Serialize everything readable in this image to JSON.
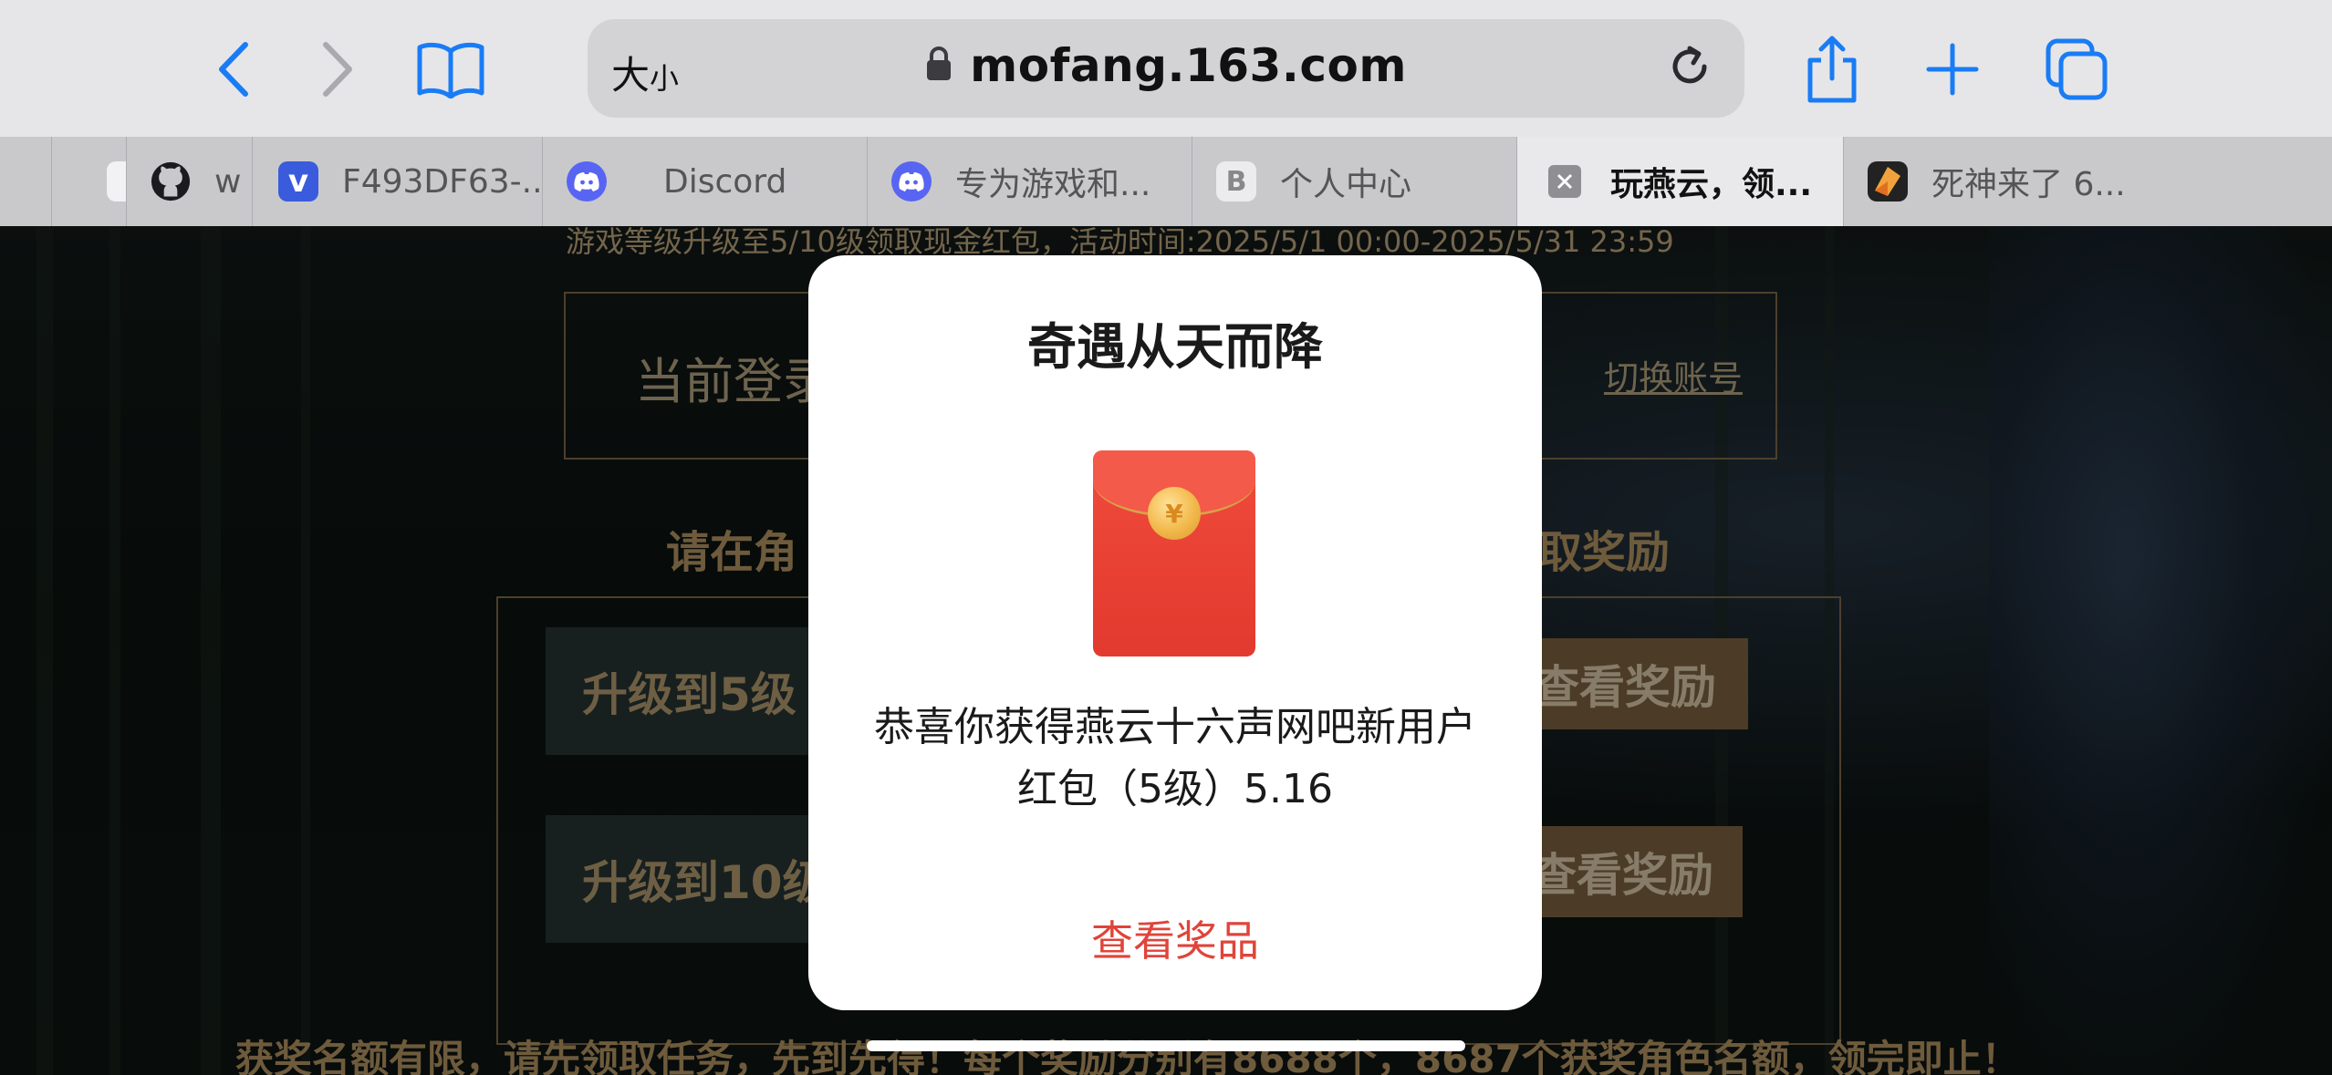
{
  "toolbar": {
    "address": {
      "text_size_label": "大",
      "text_size_label_small": "小",
      "url": "mofang.163.com"
    },
    "icons": [
      "back-icon",
      "forward-icon",
      "bookmarks-icon",
      "lock-icon",
      "reload-icon",
      "share-icon",
      "new-tab-icon",
      "tab-overview-icon"
    ]
  },
  "tabs": [
    {
      "label": "",
      "icon": "blank-tab-icon"
    },
    {
      "label": "w",
      "icon": "github-icon"
    },
    {
      "label": "F493DF63-...",
      "icon": "v-app-icon"
    },
    {
      "label": "Discord",
      "icon": "discord-icon"
    },
    {
      "label": "专为游戏和...",
      "icon": "discord-icon"
    },
    {
      "label": "个人中心",
      "icon": "b-site-icon"
    },
    {
      "label": "玩燕云，领...",
      "icon": "close-tab-icon",
      "active": true
    },
    {
      "label": "死神来了 6...",
      "icon": "site-favicon-icon"
    }
  ],
  "page": {
    "top_notice": "游戏等级升级至5/10级领取现金红包，活动时间:2025/5/1 00:00-2025/5/31 23:59",
    "login_label": "当前登录",
    "switch_account": "切换账号",
    "instruction_left": "请在角",
    "instruction_right": "取奖励",
    "level5": "升级到5级",
    "level10": "升级到10级",
    "view_reward": "查看奖励",
    "bottom_notice": "获奖名额有限，请先领取任务，先到先得！每个奖励分别有8688个，8687个获奖角色名额，领完即止！"
  },
  "modal": {
    "title": "奇遇从天而降",
    "message_line1": "恭喜你获得燕云十六声网吧新用户",
    "message_line2": "红包（5级）5.16",
    "envelope_symbol": "¥",
    "link": "查看奖品"
  },
  "colors": {
    "accent_blue": "#1a7cf5",
    "modal_link_red": "#e0443a",
    "envelope_red": "#e8402f",
    "gold_text": "#d4b98a"
  }
}
